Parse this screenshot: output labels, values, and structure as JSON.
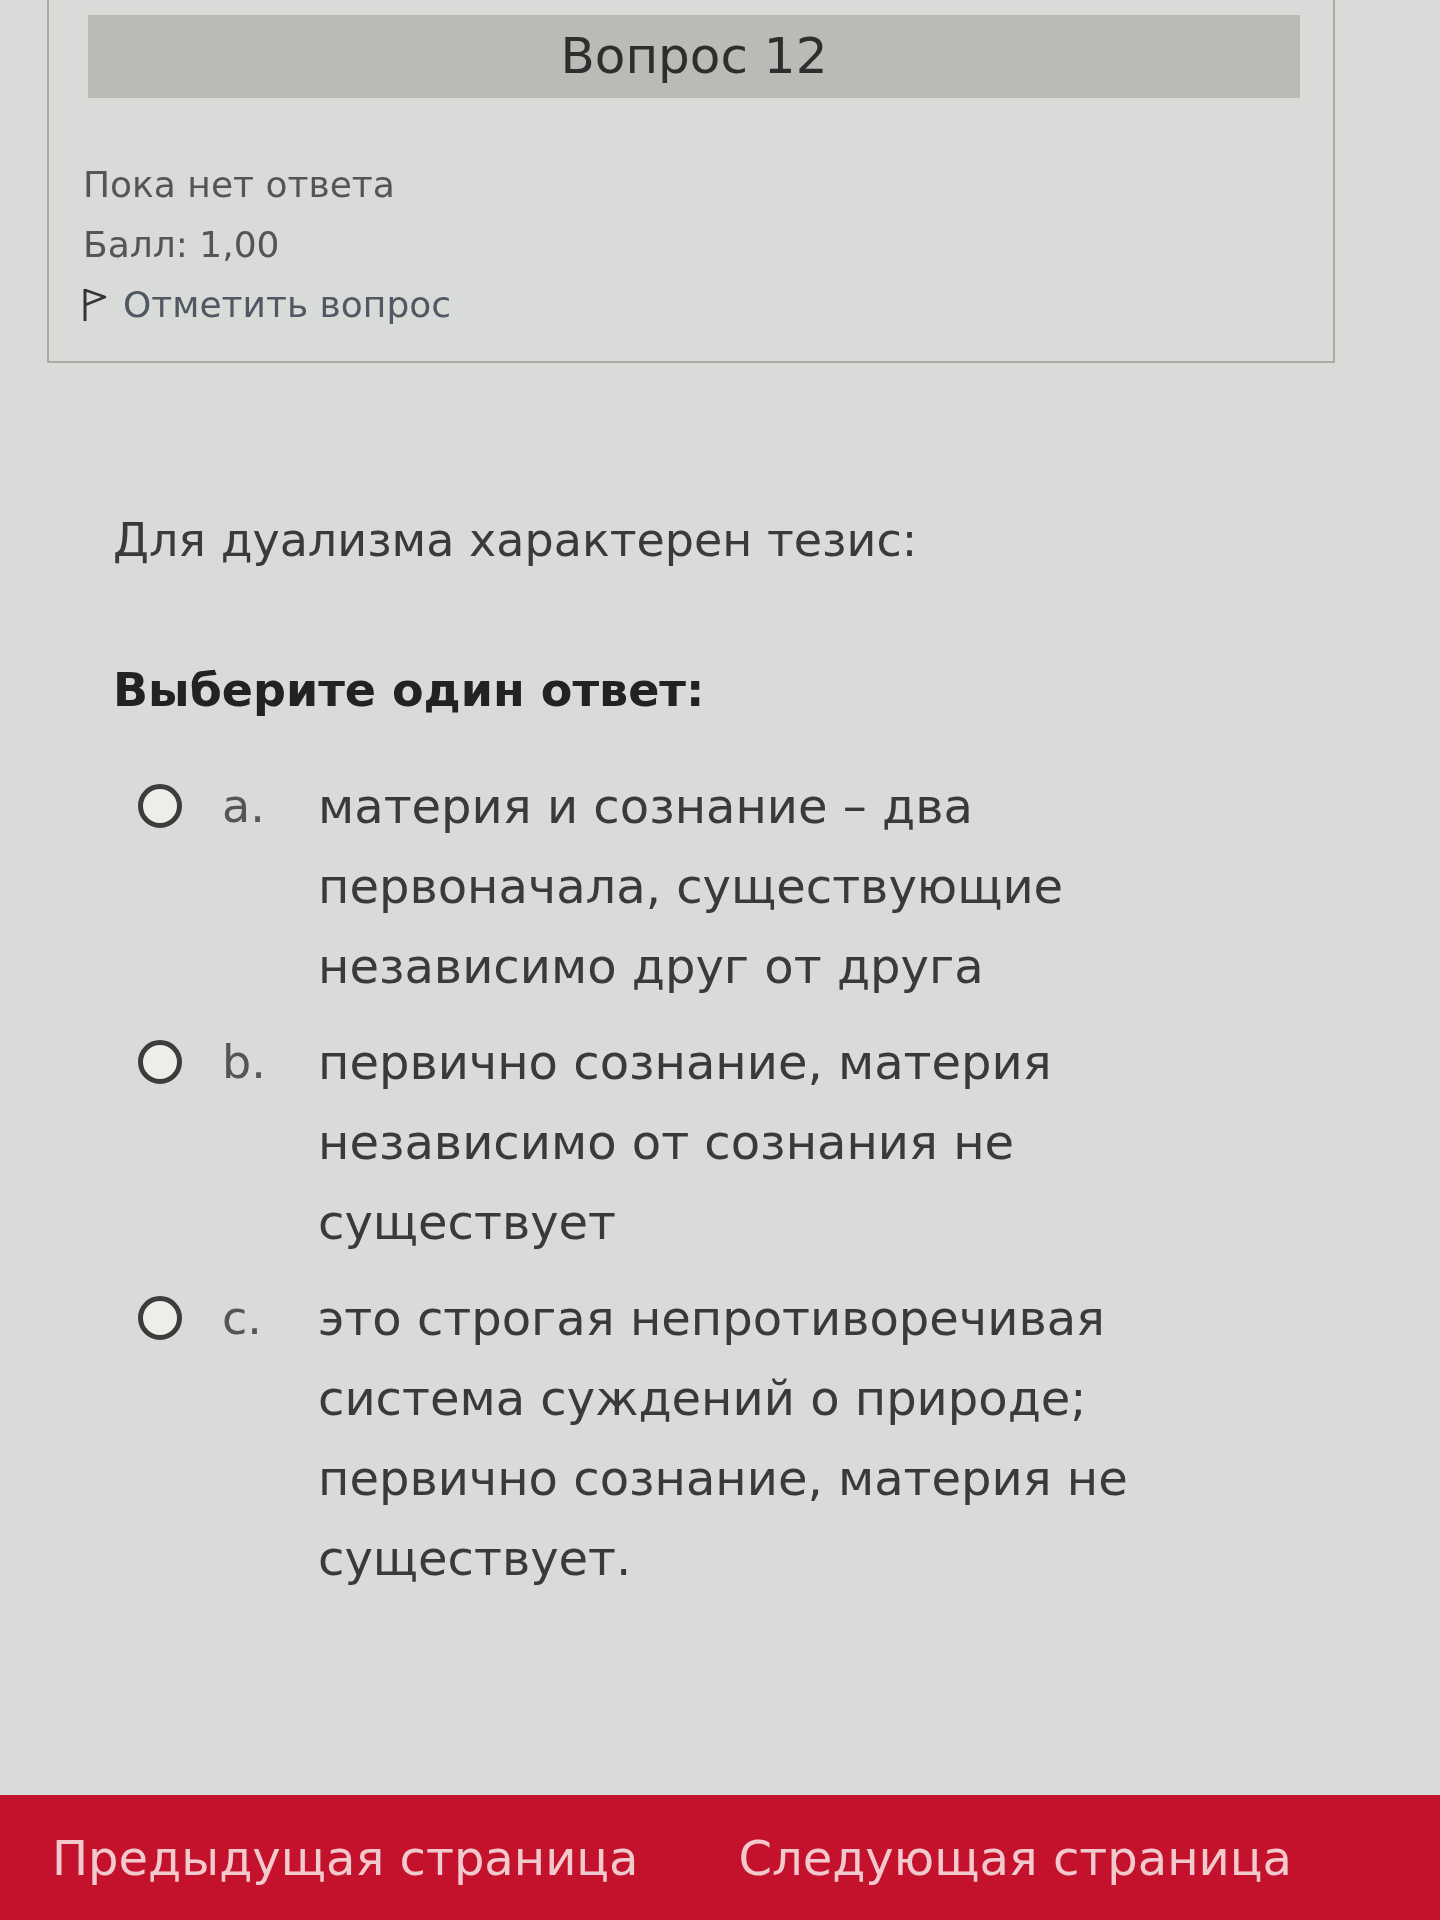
{
  "question_header": {
    "title": "Вопрос 12",
    "status": "Пока нет ответа",
    "grade": "Балл: 1,00",
    "flag_link": "Отметить вопрос",
    "flagged": false
  },
  "question": {
    "text": "Для дуализма характерен тезис:",
    "prompt": "Выберите один ответ:",
    "options": [
      {
        "letter": "a.",
        "text": "материя и сознание – два первоначала, существующие независимо друг от друга",
        "selected": false
      },
      {
        "letter": "b.",
        "text": "первично сознание, материя независимо от сознания не существует",
        "selected": false
      },
      {
        "letter": "c.",
        "text": "это строгая непротиворечивая система суждений о природе; первично сознание, материя не существует.",
        "selected": false
      }
    ]
  },
  "navigation": {
    "buttons": [
      "Предыдущая страница",
      "Следующая страница"
    ]
  }
}
